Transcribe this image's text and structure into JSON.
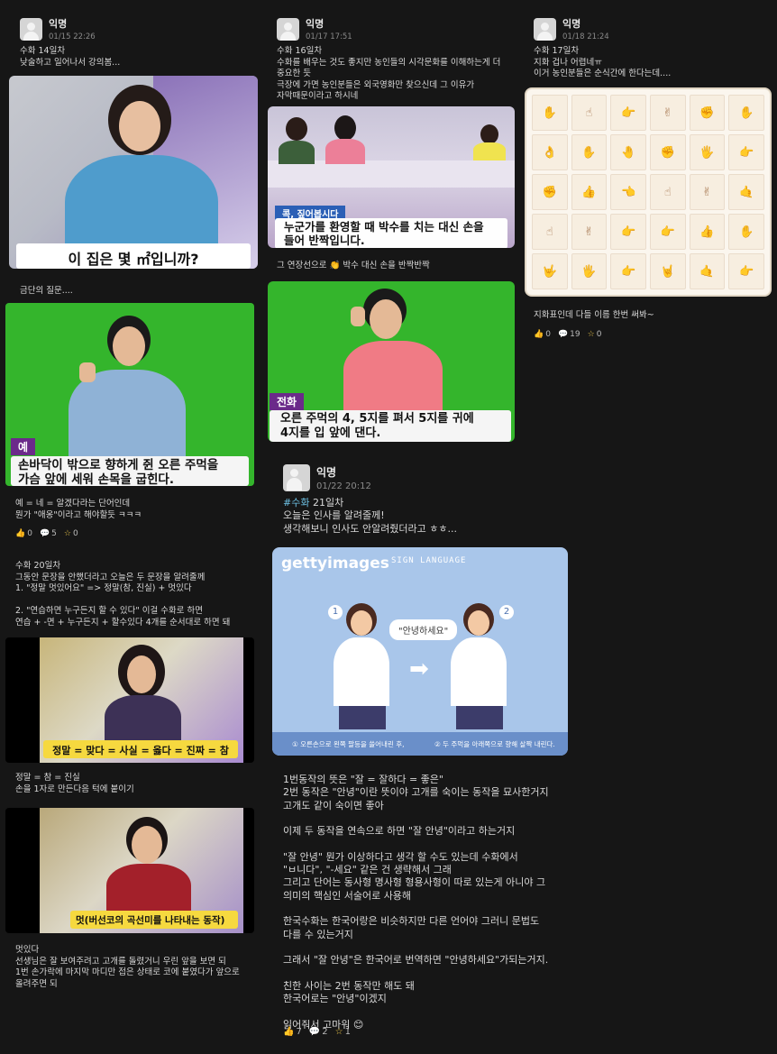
{
  "post1": {
    "author": "익명",
    "date": "01/15 22:26",
    "text": "수화 14일차\n낮술하고 일어나서 강의봄...",
    "img1_caption": "이 집은 몇 ㎡입니까?",
    "caption2": "금단의 질문....",
    "img2_tag": "예",
    "img2_caption": "손바닥이 밖으로 향하게 쥔 오른 주먹을\n가슴 앞에 세워 손목을 굽힌다.",
    "text2": "예 = 네 = 알겠다라는 단어인데\n뭔가 \"애옹\"이라고 해야할듯 ㅋㅋㅋ",
    "likes": "0",
    "comments": "5",
    "scraps": "0",
    "text3": "수화 20일차\n그동안 문장을 안했더라고 오늘은 두 문장을 알려줄께\n1. \"정말 멋있어요\" => 정말(참, 진실) + 멋있다\n\n2. \"연습하면 누구든지 할 수 있다\" 이걸 수화로 하면\n연습 + -면 + 누구든지 + 할수있다 4개를 순서대로 하면 돼",
    "img3_caption": "정말 = 맞다 = 사실 = 옳다 = 진짜 = 참",
    "text4": "정말 = 참 = 진실\n손을 1자로 만든다음 턱에 붙이기",
    "img4_caption": "멋(버선코의 곡선미를 나타내는 동작)",
    "text5": "멋있다\n선생님은 잘 보여주려고 고개를 돌렸거니 우린 앞을 보면 되\n1번 손가락에 마지막 마디만 접은 상태로 코에 붙였다가 앞으로\n올려주면 되"
  },
  "post2": {
    "author": "익명",
    "date": "01/17 17:51",
    "text": "수화 16일차\n수화를 배우는 것도 좋지만 농인들의 시각문화를 이해하는게 더\n중요한 듯\n극장에 가면 농인분들은 외국영화만 찾으신데 그 이유가\n자막때문이라고 하시네",
    "img1_tag": "콕, 짚어봅시다",
    "img1_caption": "누군가를 환영할 때 박수를 치는 대신 손을\n들어 반짝입니다.",
    "caption2": "그 연장선으로 👏 박수 대신 손을 반짝반짝",
    "img2_tag": "전화",
    "img2_caption": "오른 주먹의 4, 5지를 펴서 5지를 귀에\n4지를 입 앞에 댄다."
  },
  "post3": {
    "author": "익명",
    "date": "01/18 21:24",
    "text": "수화 17일차\n지화 겁나 어렵네ㅠ\n이거 농인분들은 순식간에 한다는데....",
    "caption": "지화표인데 다들 이름 한번 써봐~",
    "likes": "0",
    "comments": "19",
    "scraps": "0"
  },
  "post4": {
    "author": "익명",
    "date": "01/22 20:12",
    "hashtag": "#수화",
    "text_after_tag": " 21일차",
    "text": "오늘은 인사를 알려줄께!\n생각해보니 인사도 안알려줬더라고 ㅎㅎ...",
    "getty": "gettyimages",
    "sign_title": "SIGN LANGUAGE",
    "bubble": "\"안녕하세요\"",
    "step1": "① 오른손으로 왼쪽 팔등을 쓸어내린 후,",
    "step2": "② 두 주먹을 아래쪽으로 향해 살짝 내린다.",
    "body": "1번동작의 뜻은 \"잘 = 잘하다 = 좋은\"\n2번 동작은 \"안녕\"이란 뜻이야 고개를 숙이는 동작을 묘사한거지\n고개도 같이 숙이면 좋아\n\n이제 두 동작을 연속으로 하면 \"잘 안녕\"이라고 하는거지\n\n\"잘 안녕\" 뭔가 이상하다고 생각 할 수도 있는데 수화에서\n\"ㅂ니다\", \"-세요\" 같은 건 생략해서 그래\n그리고 단어는 동사형 명사형 형용사형이 따로 있는게 아니야 그\n의미의 핵심인 서술어로 사용해\n\n한국수화는 한국어랑은 비슷하지만 다른 언어야 그러니 문법도\n다를 수 있는거지\n\n그래서 \"잘 안녕\"은 한국어로 번역하면 \"안녕하세요\"가되는거지.\n\n친한 사이는 2번 동작만 해도 돼\n한국어로는 \"안녕\"이겠지\n\n읽어줘서 고마워 😊",
    "likes": "7",
    "comments": "2",
    "scraps": "1"
  }
}
